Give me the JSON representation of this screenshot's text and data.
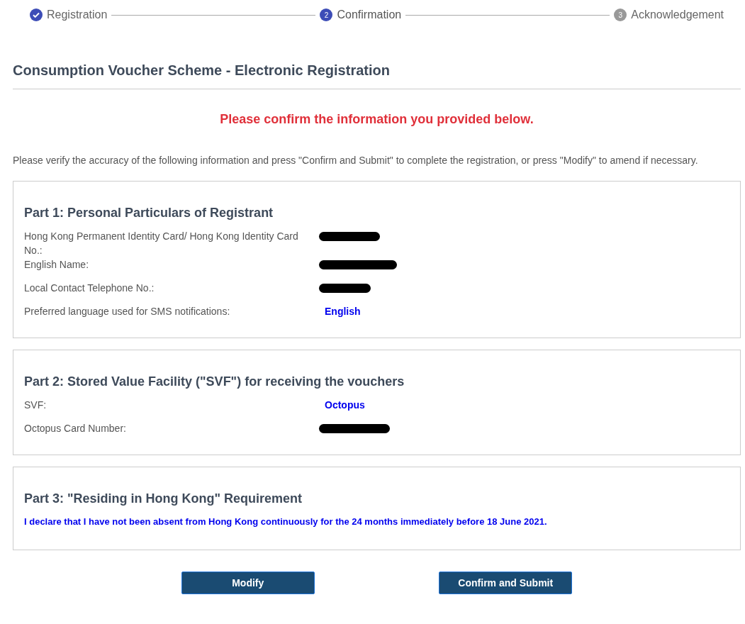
{
  "steps": [
    {
      "label": "Registration",
      "completed": true,
      "selected": false
    },
    {
      "number": "2",
      "label": "Confirmation",
      "completed": false,
      "selected": true
    },
    {
      "number": "3",
      "label": "Acknowledgement",
      "completed": false,
      "selected": false
    }
  ],
  "title": "Consumption Voucher Scheme - Electronic Registration",
  "alert": "Please confirm the information you provided below.",
  "instructions": "Please verify the accuracy of the following information and press \"Confirm and Submit\" to complete the registration, or press \"Modify\" to amend if necessary.",
  "sections": [
    {
      "heading": "Part 1: Personal Particulars of Registrant",
      "fields": [
        {
          "label": "Hong Kong Permanent Identity Card/ Hong Kong Identity Card No.:",
          "kind": "redacted"
        },
        {
          "label": "English Name:",
          "kind": "redacted"
        },
        {
          "label": "Local Contact Telephone No.:",
          "kind": "redacted"
        },
        {
          "label": "Preferred language used for SMS notifications:",
          "kind": "text",
          "value": "English"
        }
      ]
    },
    {
      "heading": "Part 2: Stored Value Facility (\"SVF\") for receiving the vouchers",
      "fields": [
        {
          "label": "SVF:",
          "kind": "text",
          "value": "Octopus"
        },
        {
          "label": "Octopus Card Number:",
          "kind": "redacted"
        }
      ]
    },
    {
      "heading": "Part 3: \"Residing in Hong Kong\" Requirement",
      "statement": "I declare that I have not been absent from Hong Kong continuously for the 24 months immediately before 18 June 2021."
    }
  ],
  "buttons": [
    {
      "label": "Modify"
    },
    {
      "label": "Confirm and Submit"
    }
  ]
}
